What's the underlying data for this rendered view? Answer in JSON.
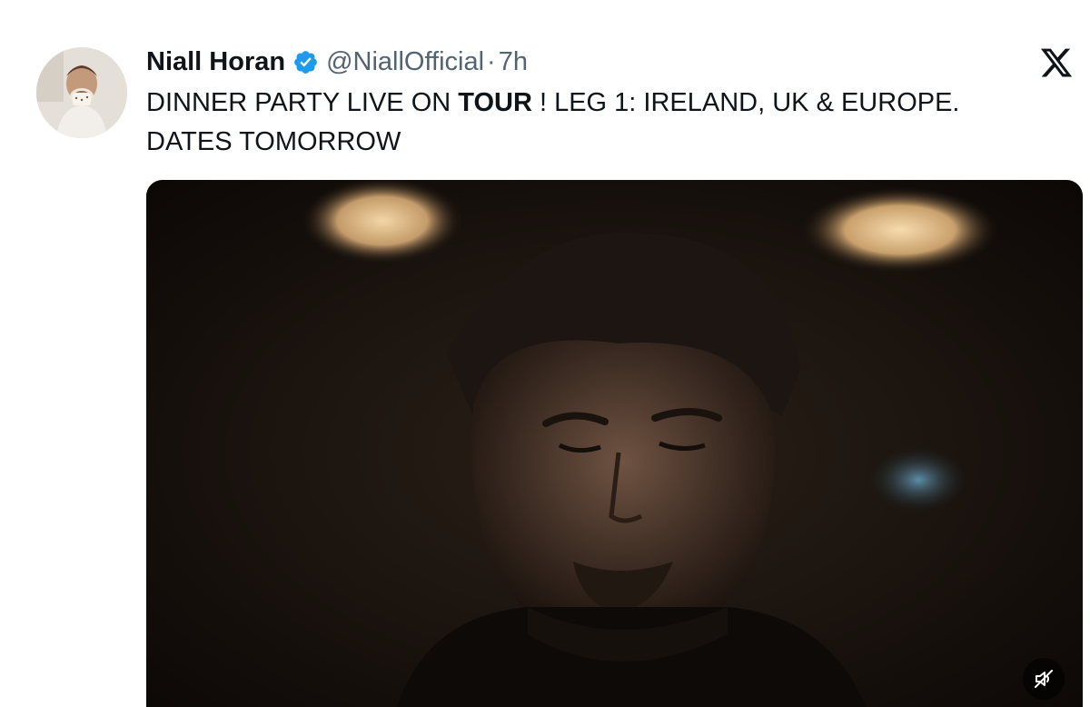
{
  "tweet": {
    "display_name": "Niall Horan",
    "handle": "@NiallOfficial",
    "separator": "·",
    "time": "7h",
    "text_part1": "DINNER PARTY LIVE ON ",
    "text_bold": "TOUR",
    "text_part2": " ! LEG 1: IRELAND, UK & EUROPE.",
    "text_line2": "DATES TOMORROW"
  },
  "icons": {
    "verified": "verified-badge-icon",
    "brand": "x-logo-icon",
    "mute": "muted-speaker-icon"
  },
  "colors": {
    "text": "#0f1419",
    "secondary": "#536471",
    "verified": "#1d9bf0",
    "media_background": "#120d09"
  }
}
